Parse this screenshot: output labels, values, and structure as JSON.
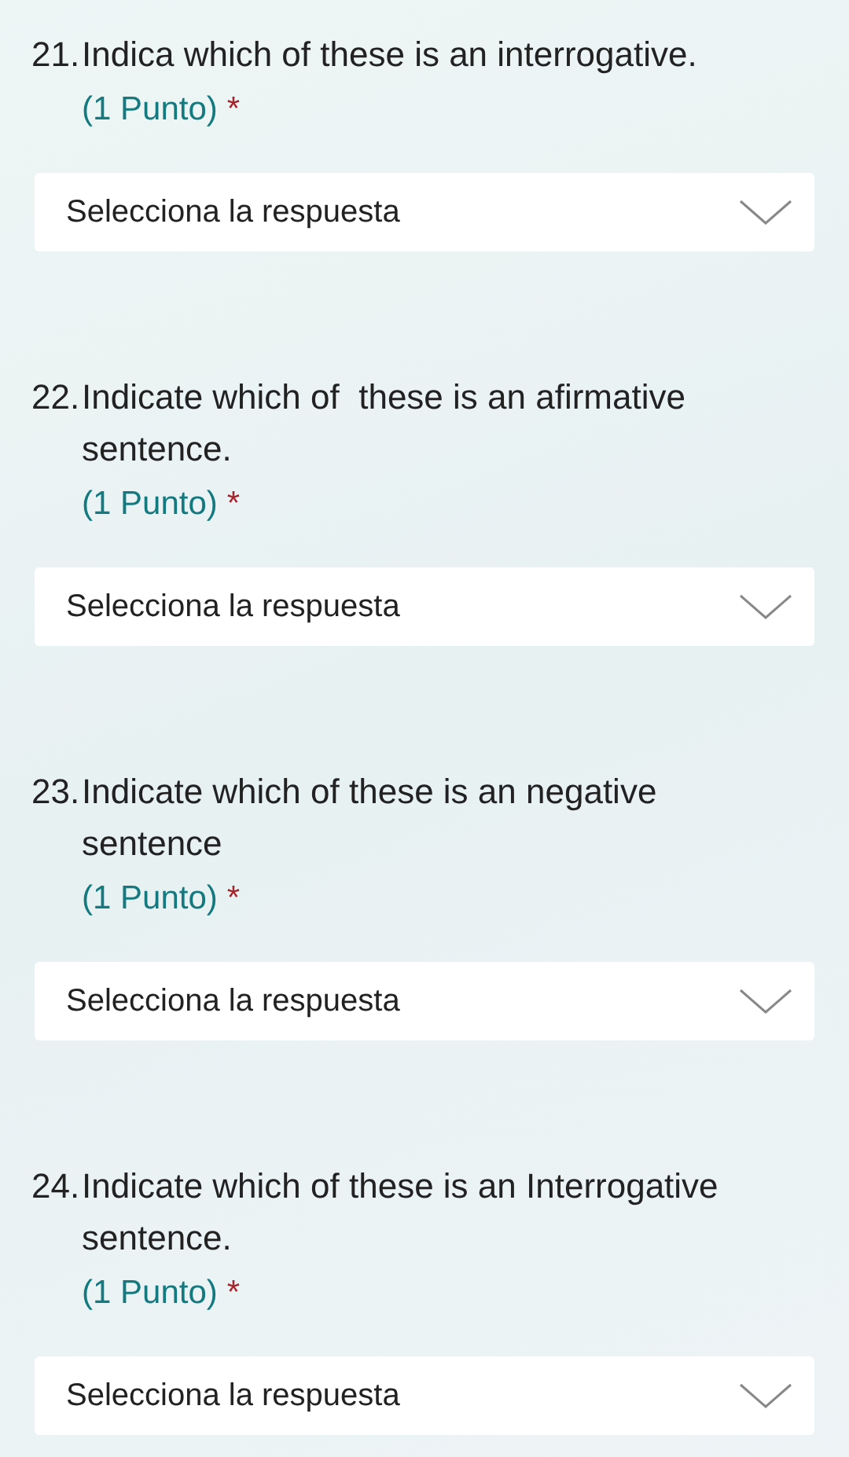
{
  "questions": [
    {
      "number": "21.",
      "text": "Indica which of these is an interrogative.",
      "points": "(1 Punto)",
      "required_mark": "*",
      "dropdown": {
        "placeholder": "Selecciona la respuesta"
      }
    },
    {
      "number": "22.",
      "text": "Indicate which of  these is an afirmative sentence.",
      "points": "(1 Punto)",
      "required_mark": "*",
      "dropdown": {
        "placeholder": "Selecciona la respuesta"
      }
    },
    {
      "number": "23.",
      "text": "Indicate which of these is an negative sentence",
      "points": "(1 Punto)",
      "required_mark": "*",
      "dropdown": {
        "placeholder": "Selecciona la respuesta"
      }
    },
    {
      "number": "24.",
      "text": "Indicate which of these is an Interrogative sentence.",
      "points": "(1 Punto)",
      "required_mark": "*",
      "dropdown": {
        "placeholder": "Selecciona la respuesta"
      }
    }
  ]
}
